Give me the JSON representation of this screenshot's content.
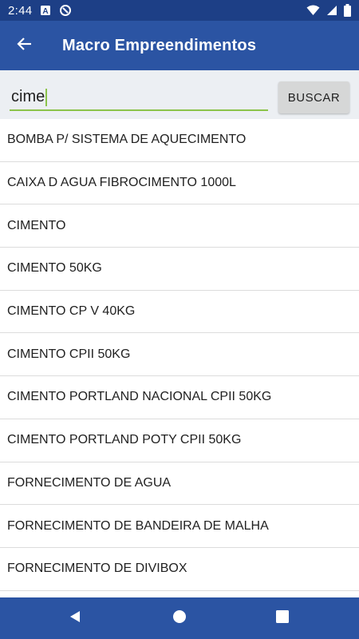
{
  "status_bar": {
    "time": "2:44",
    "icons": [
      "font-app-icon",
      "sync-icon",
      "wifi-icon",
      "signal-icon",
      "battery-icon"
    ]
  },
  "app_bar": {
    "title": "Macro Empreendimentos",
    "back_icon": "arrow-back-icon"
  },
  "search": {
    "value": "cime",
    "button_label": "BUSCAR"
  },
  "results": [
    "BOMBA P/ SISTEMA DE AQUECIMENTO",
    "CAIXA D AGUA FIBROCIMENTO 1000L",
    "CIMENTO",
    "CIMENTO 50KG",
    "CIMENTO CP V 40KG",
    "CIMENTO CPII 50KG",
    "CIMENTO PORTLAND NACIONAL CPII 50KG",
    "CIMENTO PORTLAND POTY CPII 50KG",
    "FORNECIMENTO DE AGUA",
    "FORNECIMENTO DE BANDEIRA DE MALHA",
    "FORNECIMENTO DE DIVIBOX"
  ],
  "nav_bar": {
    "icons": [
      "back-triangle-icon",
      "home-circle-icon",
      "recents-square-icon"
    ]
  },
  "colors": {
    "status_bar": "#1d3f86",
    "app_bar": "#2b54a3",
    "search_background": "#eceff3",
    "input_underline": "#8bc34a",
    "button_background": "#d6d7d7"
  }
}
